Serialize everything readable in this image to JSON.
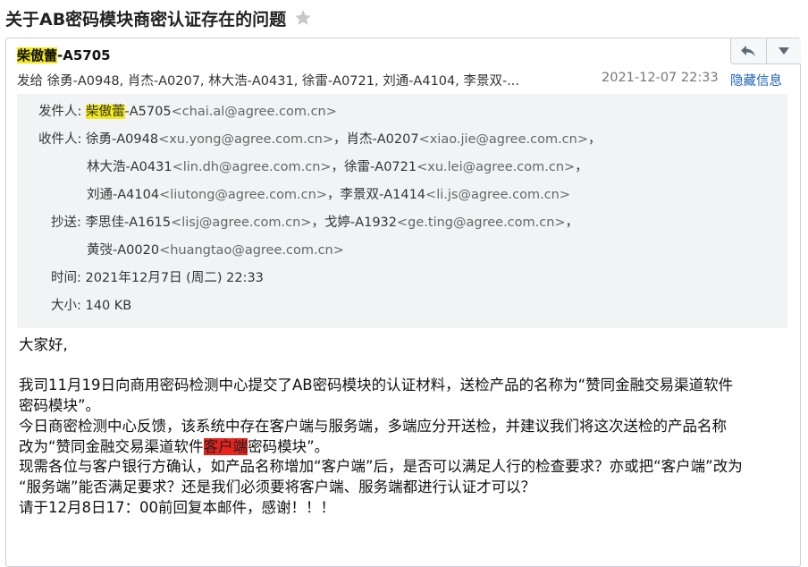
{
  "subject": "关于AB密码模块商密认证存在的问题",
  "header": {
    "sender_name": "柴傲蕾",
    "sender_id": "-A5705",
    "recipients_summary": "发给 徐勇-A0948, 肖杰-A0207, 林大浩-A0431, 徐雷-A0721, 刘通-A4104, 李景双-...",
    "date": "2021-12-07 22:33",
    "hide_label": "隐藏信息"
  },
  "details": {
    "from_label": "发件人:",
    "from_name": "柴傲蕾",
    "from_rest": "-A5705",
    "from_email": "<chai.al@agree.com.cn>",
    "to_label": "收件人:",
    "to_lines": [
      [
        {
          "t": "徐勇-A0948"
        },
        {
          "t": "<xu.yong@agree.com.cn>",
          "g": 1
        },
        {
          "t": "，肖杰-A0207"
        },
        {
          "t": "<xiao.jie@agree.com.cn>",
          "g": 1
        },
        {
          "t": "，"
        }
      ],
      [
        {
          "t": "林大浩-A0431"
        },
        {
          "t": "<lin.dh@agree.com.cn>",
          "g": 1
        },
        {
          "t": "，徐雷-A0721"
        },
        {
          "t": "<xu.lei@agree.com.cn>",
          "g": 1
        },
        {
          "t": "，"
        }
      ],
      [
        {
          "t": "刘通-A4104"
        },
        {
          "t": "<liutong@agree.com.cn>",
          "g": 1
        },
        {
          "t": "，李景双-A1414"
        },
        {
          "t": "<li.js@agree.com.cn>",
          "g": 1
        }
      ]
    ],
    "cc_label": "抄送:",
    "cc_lines": [
      [
        {
          "t": "李思佳-A1615"
        },
        {
          "t": "<lisj@agree.com.cn>",
          "g": 1
        },
        {
          "t": "，戈婷-A1932"
        },
        {
          "t": "<ge.ting@agree.com.cn>",
          "g": 1
        },
        {
          "t": "，"
        }
      ],
      [
        {
          "t": "黄弢-A0020"
        },
        {
          "t": "<huangtao@agree.com.cn>",
          "g": 1
        }
      ]
    ],
    "time_label": "时间:",
    "time_value": "2021年12月7日 (周二) 22:33",
    "size_label": "大小:",
    "size_value": "140 KB"
  },
  "body": {
    "greeting": "大家好,",
    "p1_l1": "我司11月19日向商用密码检测中心提交了AB密码模块的认证材料，送检产品的名称为“赞同金融交易渠道软件",
    "p1_l2": "密码模块”。",
    "p2_l1": "今日商密检测中心反馈，该系统中存在客户端与服务端，多端应分开送检，并建议我们将这次送检的产品名称",
    "p2_l2_a": "改为“赞同金融交易渠道软件",
    "p2_l2_hl": "客户端",
    "p2_l2_b": "密码模块”。",
    "p3_l1": "现需各位与客户银行方确认，如产品名称增加“客户端”后，是否可以满足人行的检查要求？亦或把“客户端”改为",
    "p3_l2": "“服务端”能否满足要求？还是我们必须要将客户端、服务端都进行认证才可以？",
    "p4": "请于12月8日17：00前回复本邮件，感谢！！！"
  }
}
